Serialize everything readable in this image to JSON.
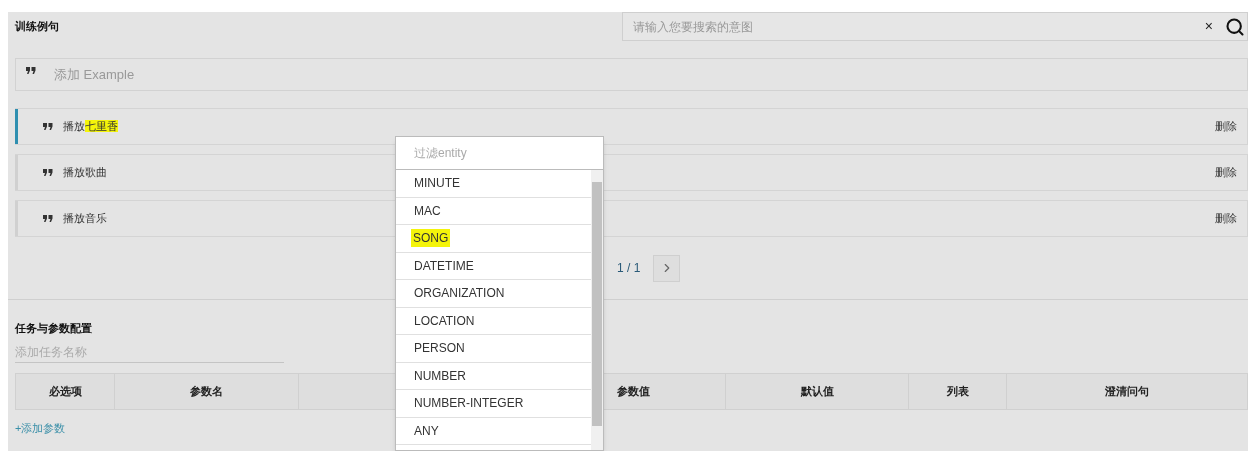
{
  "examples_section": {
    "title": "训练例句",
    "search": {
      "placeholder": "请输入您要搜索的意图",
      "clear": "×"
    },
    "add_example": {
      "placeholder": "添加 Example"
    },
    "examples": [
      {
        "selected": true,
        "segments": [
          {
            "text": "播放",
            "highlighted": false
          },
          {
            "text": "七里香",
            "highlighted": true
          }
        ],
        "delete": "删除"
      },
      {
        "selected": false,
        "segments": [
          {
            "text": "播放歌曲",
            "highlighted": false
          }
        ],
        "delete": "删除"
      },
      {
        "selected": false,
        "segments": [
          {
            "text": "播放音乐",
            "highlighted": false
          }
        ],
        "delete": "删除"
      }
    ],
    "pagination": {
      "page": "1 / 1"
    }
  },
  "task_section": {
    "title": "任务与参数配置",
    "task_name": {
      "placeholder": "添加任务名称"
    },
    "table": {
      "columns": [
        {
          "label": "必选项"
        },
        {
          "label": "参数名"
        },
        {},
        {
          "label": "参数值"
        },
        {
          "label": "默认值"
        },
        {
          "label": "列表"
        },
        {
          "label": "澄清问句"
        }
      ]
    },
    "add_parameter": "+添加参数"
  },
  "entity_dropdown": {
    "filter": {
      "placeholder": "过滤entity"
    },
    "items": [
      {
        "label": "MINUTE",
        "highlighted": false
      },
      {
        "label": "MAC",
        "highlighted": false
      },
      {
        "label": "SONG",
        "highlighted": true
      },
      {
        "label": "DATETIME",
        "highlighted": false
      },
      {
        "label": "ORGANIZATION",
        "highlighted": false
      },
      {
        "label": "LOCATION",
        "highlighted": false
      },
      {
        "label": "PERSON",
        "highlighted": false
      },
      {
        "label": "NUMBER",
        "highlighted": false
      },
      {
        "label": "NUMBER-INTEGER",
        "highlighted": false
      },
      {
        "label": "ANY",
        "highlighted": false
      }
    ]
  }
}
